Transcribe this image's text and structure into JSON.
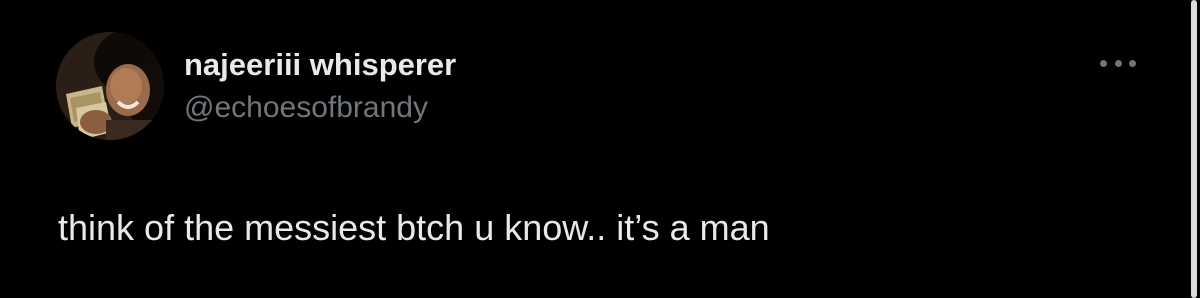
{
  "tweet": {
    "author": {
      "display_name": "najeeriii whisperer",
      "handle": "@echoesofbrandy"
    },
    "text": "think of the messiest btch u know.. it’s a man"
  },
  "icons": {
    "more": "more-horizontal-icon",
    "avatar": "profile-avatar"
  },
  "colors": {
    "background": "#000000",
    "primary_text": "#e7e9ea",
    "secondary_text": "#71767b"
  }
}
